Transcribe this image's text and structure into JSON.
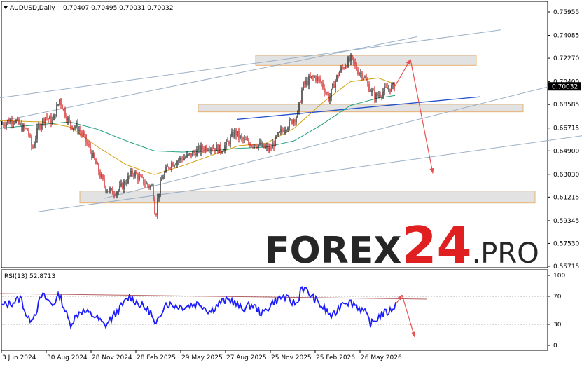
{
  "header": {
    "symbol": "AUDUSD,Daily",
    "ohlc": "0.70407 0.70495 0.70031 0.70032"
  },
  "rsi_label": "RSI(13) 52.8713",
  "watermark": {
    "main": "FOREX24",
    "num": "24",
    "word": "FOREX",
    "suffix": ".PRO"
  },
  "colors": {
    "bull": "#000000",
    "bear": "#cc0000",
    "ma_fast": "#d4a017",
    "ma_slow": "#20a080",
    "rsi_line": "#1c1cff",
    "trend_blue": "#2450c8",
    "channel": "#9ab0c6",
    "zone_fill": "#e2e2e2",
    "zone_border": "#e8b070",
    "arrow": "#e85050",
    "watermark_dark": "#262626",
    "watermark_red": "#e02020"
  },
  "chart_data": {
    "type": "line",
    "title": "AUDUSD,Daily",
    "price_axis": {
      "ticks": [
        0.75955,
        0.74085,
        0.7227,
        0.704,
        0.68585,
        0.66715,
        0.649,
        0.6303,
        0.61215,
        0.59345,
        0.5753,
        0.55715
      ],
      "labels": [
        "0.75955",
        "0.74085",
        "0.72270",
        "0.70400",
        "0.68585",
        "0.66715",
        "0.64900",
        "0.63030",
        "0.61215",
        "0.59345",
        "0.57530",
        "0.55715"
      ],
      "current": "0.70032",
      "ylim": [
        0.5525,
        0.7675
      ]
    },
    "time_axis": {
      "labels": [
        "3 Jun 2024",
        "30 Aug 2024",
        "28 Nov 2024",
        "28 Feb 2025",
        "29 May 2025",
        "27 Aug 2025",
        "25 Nov 2025",
        "25 Feb 2026",
        "26 May 2026"
      ]
    },
    "price_path": [
      [
        0,
        0.67
      ],
      [
        10,
        0.672
      ],
      [
        20,
        0.674
      ],
      [
        30,
        0.668
      ],
      [
        40,
        0.665
      ],
      [
        46,
        0.65
      ],
      [
        55,
        0.668
      ],
      [
        65,
        0.676
      ],
      [
        75,
        0.672
      ],
      [
        85,
        0.69
      ],
      [
        92,
        0.68
      ],
      [
        100,
        0.67
      ],
      [
        110,
        0.668
      ],
      [
        120,
        0.66
      ],
      [
        130,
        0.648
      ],
      [
        140,
        0.634
      ],
      [
        150,
        0.62
      ],
      [
        160,
        0.616
      ],
      [
        170,
        0.618
      ],
      [
        180,
        0.625
      ],
      [
        190,
        0.632
      ],
      [
        200,
        0.627
      ],
      [
        210,
        0.622
      ],
      [
        218,
        0.62
      ],
      [
        222,
        0.596
      ],
      [
        226,
        0.615
      ],
      [
        232,
        0.628
      ],
      [
        242,
        0.638
      ],
      [
        255,
        0.642
      ],
      [
        270,
        0.645
      ],
      [
        285,
        0.65
      ],
      [
        300,
        0.653
      ],
      [
        315,
        0.65
      ],
      [
        325,
        0.655
      ],
      [
        335,
        0.664
      ],
      [
        345,
        0.658
      ],
      [
        355,
        0.655
      ],
      [
        365,
        0.655
      ],
      [
        375,
        0.652
      ],
      [
        385,
        0.65
      ],
      [
        395,
        0.659
      ],
      [
        405,
        0.667
      ],
      [
        415,
        0.672
      ],
      [
        425,
        0.678
      ],
      [
        432,
        0.7
      ],
      [
        440,
        0.705
      ],
      [
        450,
        0.708
      ],
      [
        460,
        0.702
      ],
      [
        470,
        0.69
      ],
      [
        478,
        0.704
      ],
      [
        485,
        0.712
      ],
      [
        493,
        0.718
      ],
      [
        502,
        0.722
      ],
      [
        510,
        0.713
      ],
      [
        518,
        0.71
      ],
      [
        526,
        0.7
      ],
      [
        536,
        0.692
      ],
      [
        546,
        0.696
      ],
      [
        556,
        0.699
      ],
      [
        564,
        0.7
      ]
    ],
    "series": [
      {
        "values": [
          [
            0,
            0.673
          ],
          [
            60,
            0.672
          ],
          [
            100,
            0.668
          ],
          [
            140,
            0.652
          ],
          [
            180,
            0.638
          ],
          [
            220,
            0.63
          ],
          [
            260,
            0.637
          ],
          [
            300,
            0.645
          ],
          [
            340,
            0.653
          ],
          [
            380,
            0.655
          ],
          [
            420,
            0.667
          ],
          [
            460,
            0.687
          ],
          [
            500,
            0.704
          ],
          [
            540,
            0.707
          ],
          [
            564,
            0.702
          ]
        ]
      },
      {
        "values": [
          [
            0,
            0.667
          ],
          [
            60,
            0.67
          ],
          [
            100,
            0.672
          ],
          [
            140,
            0.666
          ],
          [
            180,
            0.657
          ],
          [
            220,
            0.649
          ],
          [
            260,
            0.648
          ],
          [
            300,
            0.649
          ],
          [
            340,
            0.651
          ],
          [
            380,
            0.652
          ],
          [
            420,
            0.657
          ],
          [
            460,
            0.67
          ],
          [
            500,
            0.685
          ],
          [
            540,
            0.691
          ],
          [
            564,
            0.693
          ]
        ]
      }
    ],
    "zones": [
      {
        "x": [
          365,
          680
        ],
        "y": [
          0.717,
          0.725
        ]
      },
      {
        "x": [
          283,
          747
        ],
        "y": [
          0.68,
          0.686
        ]
      },
      {
        "x": [
          114,
          764
        ],
        "y": [
          0.6075,
          0.617
        ]
      }
    ],
    "lines": [
      {
        "kind": "trend",
        "from": [
          338,
          0.674
        ],
        "to": [
          686,
          0.692
        ]
      },
      {
        "kind": "channel",
        "from": [
          0,
          0.6912
        ],
        "to": [
          715,
          0.7452
        ]
      },
      {
        "kind": "channel",
        "from": [
          0,
          0.6725
        ],
        "to": [
          596,
          0.7398
        ]
      },
      {
        "kind": "channel",
        "from": [
          148,
          0.611
        ],
        "to": [
          790,
          0.701
        ]
      },
      {
        "kind": "channel",
        "from": [
          54,
          0.6005
        ],
        "to": [
          831,
          0.661
        ]
      }
    ],
    "arrows": [
      {
        "from": [
          564,
          0.7005
        ],
        "to": [
          586,
          0.7218
        ]
      },
      {
        "from": [
          586,
          0.7218
        ],
        "to": [
          618,
          0.631
        ]
      }
    ],
    "rsi": {
      "period": 13,
      "value": 52.8713,
      "levels": [
        70,
        30
      ],
      "axis_labels": [
        "100",
        "70",
        "30",
        "0"
      ],
      "values": [
        [
          0,
          55
        ],
        [
          20,
          62
        ],
        [
          30,
          68
        ],
        [
          40,
          35
        ],
        [
          50,
          45
        ],
        [
          60,
          72
        ],
        [
          75,
          58
        ],
        [
          85,
          72
        ],
        [
          100,
          30
        ],
        [
          115,
          50
        ],
        [
          135,
          42
        ],
        [
          150,
          28
        ],
        [
          165,
          45
        ],
        [
          185,
          70
        ],
        [
          200,
          58
        ],
        [
          215,
          48
        ],
        [
          222,
          25
        ],
        [
          235,
          60
        ],
        [
          260,
          55
        ],
        [
          285,
          60
        ],
        [
          300,
          48
        ],
        [
          315,
          62
        ],
        [
          330,
          65
        ],
        [
          345,
          52
        ],
        [
          360,
          58
        ],
        [
          375,
          45
        ],
        [
          390,
          62
        ],
        [
          405,
          70
        ],
        [
          415,
          62
        ],
        [
          425,
          60
        ],
        [
          430,
          85
        ],
        [
          445,
          70
        ],
        [
          460,
          55
        ],
        [
          475,
          40
        ],
        [
          490,
          64
        ],
        [
          505,
          60
        ],
        [
          520,
          48
        ],
        [
          530,
          30
        ],
        [
          545,
          45
        ],
        [
          556,
          48
        ],
        [
          566,
          60
        ]
      ],
      "trend": {
        "from": [
          0,
          74
        ],
        "to": [
          610,
          66
        ]
      },
      "arrows": [
        {
          "from": [
            566,
            60
          ],
          "to": [
            574,
            72
          ]
        },
        {
          "from": [
            574,
            72
          ],
          "to": [
            592,
            12
          ]
        }
      ]
    }
  }
}
